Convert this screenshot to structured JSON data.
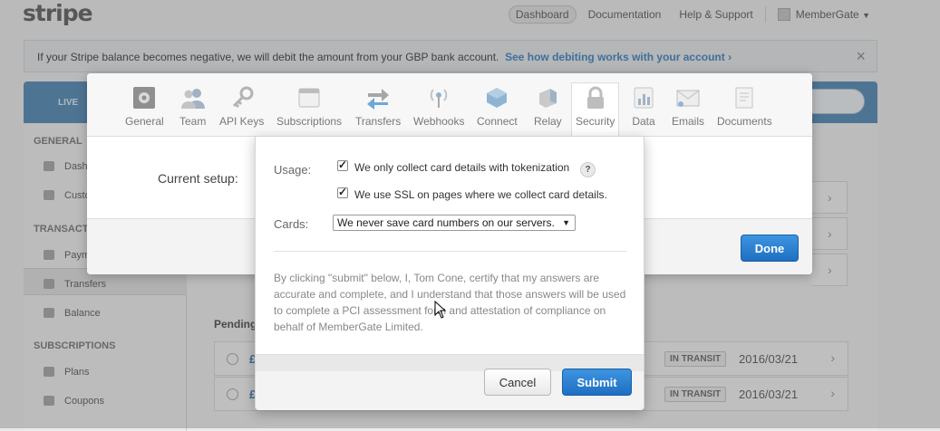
{
  "brand": {
    "logo": "stripe"
  },
  "topnav": {
    "dashboard": "Dashboard",
    "documentation": "Documentation",
    "help": "Help & Support",
    "account": "MemberGate"
  },
  "banner": {
    "text": "If your Stripe balance becomes negative, we will debit the amount from your GBP bank account.",
    "link": "See how debiting works with your account ›"
  },
  "mode": "LIVE",
  "sidebar": {
    "general_heading": "GENERAL",
    "items": [
      "Dash",
      "Custo",
      "Paym",
      "Transfers",
      "Balance",
      "Plans",
      "Coupons"
    ],
    "transactions_heading": "TRANSACT",
    "subscriptions_heading": "SUBSCRIPTIONS"
  },
  "content": {
    "pending_heading": "Pending",
    "rows": [
      {
        "amount": "£",
        "status": "IN TRANSIT",
        "date": "2016/03/21"
      },
      {
        "amount": "£",
        "status": "IN TRANSIT",
        "date": "2016/03/21"
      }
    ]
  },
  "settings": {
    "tabs": [
      {
        "label": "General",
        "icon": "general-icon"
      },
      {
        "label": "Team",
        "icon": "team-icon"
      },
      {
        "label": "API Keys",
        "icon": "key-icon"
      },
      {
        "label": "Subscriptions",
        "icon": "subscriptions-icon"
      },
      {
        "label": "Transfers",
        "icon": "transfers-icon"
      },
      {
        "label": "Webhooks",
        "icon": "webhooks-icon"
      },
      {
        "label": "Connect",
        "icon": "connect-icon"
      },
      {
        "label": "Relay",
        "icon": "relay-icon"
      },
      {
        "label": "Security",
        "icon": "lock-icon"
      },
      {
        "label": "Data",
        "icon": "data-icon"
      },
      {
        "label": "Emails",
        "icon": "email-icon"
      },
      {
        "label": "Documents",
        "icon": "documents-icon"
      }
    ],
    "selected_tab": "Security",
    "current_setup_label": "Current setup:",
    "done_label": "Done"
  },
  "pci_dialog": {
    "usage_label": "Usage:",
    "check1": "We only collect card details with tokenization",
    "check2": "We use SSL on pages where we collect card details.",
    "help": "?",
    "cards_label": "Cards:",
    "cards_value": "We never save card numbers on our servers.",
    "certification": "By clicking \"submit\" below, I, Tom Cone, certify that my answers are accurate and complete, and I understand that those answers will be used to complete a PCI assessment form and attestation of compliance on behalf of MemberGate Limited.",
    "cancel_label": "Cancel",
    "submit_label": "Submit"
  },
  "colors": {
    "accent": "#2a7fd4",
    "link": "#2570b5",
    "live_bar": "#3b78ab"
  }
}
